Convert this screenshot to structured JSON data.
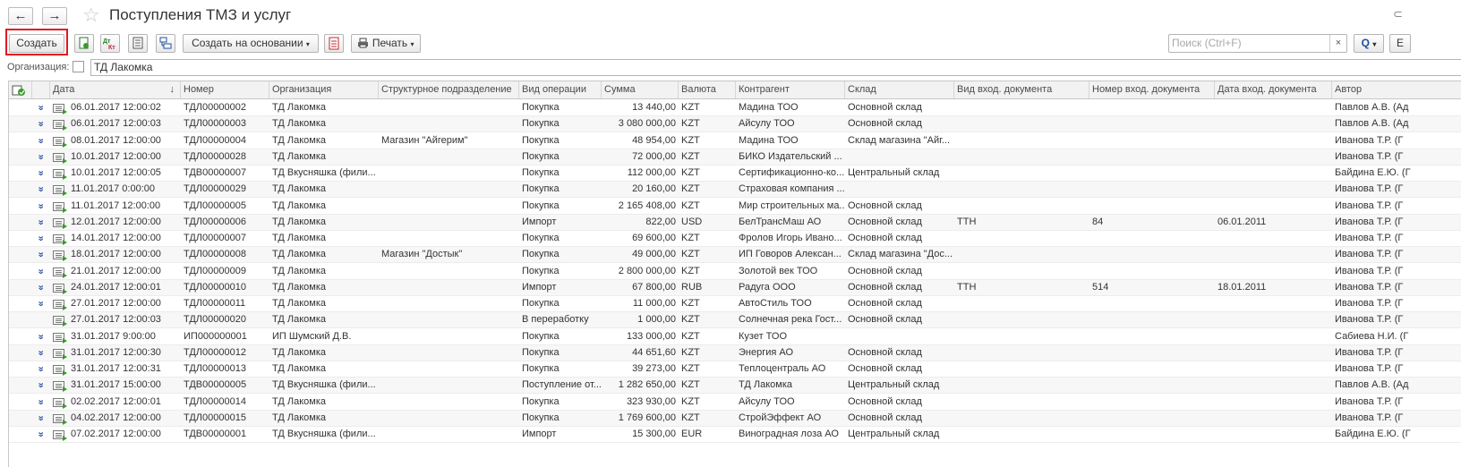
{
  "header": {
    "back_icon": "←",
    "forward_icon": "→",
    "favorite_icon": "☆",
    "title": "Поступления ТМЗ и услуг",
    "link_icon": "⊂"
  },
  "toolbar": {
    "create_label": "Создать",
    "create_based_label": "Создать на основании",
    "print_label": "Печать",
    "search_placeholder": "Поиск (Ctrl+F)",
    "clear_icon": "×",
    "search_icon": "Q",
    "more_label": "Е"
  },
  "filter": {
    "org_label": "Организация:",
    "org_value": "ТД Лакомка"
  },
  "columns": {
    "date": "Дата",
    "number": "Номер",
    "org": "Организация",
    "subdivision": "Структурное подразделение",
    "operation": "Вид операции",
    "sum": "Сумма",
    "currency": "Валюта",
    "counterparty": "Контрагент",
    "warehouse": "Склад",
    "in_doc_type": "Вид вход. документа",
    "in_doc_number": "Номер вход. документа",
    "in_doc_date": "Дата вход. документа",
    "author": "Автор"
  },
  "rows": [
    {
      "posted": true,
      "date": "06.01.2017 12:00:02",
      "number": "ТДЛ00000002",
      "org": "ТД Лакомка",
      "subdivision": "",
      "operation": "Покупка",
      "sum": "13 440,00",
      "currency": "KZT",
      "counterparty": "Мадина ТОО",
      "warehouse": "Основной склад",
      "in_doc_type": "",
      "in_doc_number": "",
      "in_doc_date": "",
      "author": "Павлов А.В. (Ад"
    },
    {
      "posted": true,
      "date": "06.01.2017 12:00:03",
      "number": "ТДЛ00000003",
      "org": "ТД Лакомка",
      "subdivision": "",
      "operation": "Покупка",
      "sum": "3 080 000,00",
      "currency": "KZT",
      "counterparty": "Айсулу ТОО",
      "warehouse": "Основной склад",
      "in_doc_type": "",
      "in_doc_number": "",
      "in_doc_date": "",
      "author": "Павлов А.В. (Ад"
    },
    {
      "posted": true,
      "date": "08.01.2017 12:00:00",
      "number": "ТДЛ00000004",
      "org": "ТД Лакомка",
      "subdivision": "Магазин \"Айгерим\"",
      "operation": "Покупка",
      "sum": "48 954,00",
      "currency": "KZT",
      "counterparty": "Мадина ТОО",
      "warehouse": "Склад магазина \"Айг...",
      "in_doc_type": "",
      "in_doc_number": "",
      "in_doc_date": "",
      "author": "Иванова Т.Р. (Г"
    },
    {
      "posted": true,
      "date": "10.01.2017 12:00:00",
      "number": "ТДЛ00000028",
      "org": "ТД Лакомка",
      "subdivision": "",
      "operation": "Покупка",
      "sum": "72 000,00",
      "currency": "KZT",
      "counterparty": "БИКО Издательский ...",
      "warehouse": "",
      "in_doc_type": "",
      "in_doc_number": "",
      "in_doc_date": "",
      "author": "Иванова Т.Р. (Г"
    },
    {
      "posted": true,
      "date": "10.01.2017 12:00:05",
      "number": "ТДВ00000007",
      "org": "ТД Вкусняшка (фили...",
      "subdivision": "",
      "operation": "Покупка",
      "sum": "112 000,00",
      "currency": "KZT",
      "counterparty": "Сертификационно-ко...",
      "warehouse": "Центральный склад",
      "in_doc_type": "",
      "in_doc_number": "",
      "in_doc_date": "",
      "author": "Байдина Е.Ю. (Г"
    },
    {
      "posted": true,
      "date": "11.01.2017 0:00:00",
      "number": "ТДЛ00000029",
      "org": "ТД Лакомка",
      "subdivision": "",
      "operation": "Покупка",
      "sum": "20 160,00",
      "currency": "KZT",
      "counterparty": "Страховая компания ...",
      "warehouse": "",
      "in_doc_type": "",
      "in_doc_number": "",
      "in_doc_date": "",
      "author": "Иванова Т.Р. (Г"
    },
    {
      "posted": true,
      "date": "11.01.2017 12:00:00",
      "number": "ТДЛ00000005",
      "org": "ТД Лакомка",
      "subdivision": "",
      "operation": "Покупка",
      "sum": "2 165 408,00",
      "currency": "KZT",
      "counterparty": "Мир строительных ма...",
      "warehouse": "Основной склад",
      "in_doc_type": "",
      "in_doc_number": "",
      "in_doc_date": "",
      "author": "Иванова Т.Р. (Г"
    },
    {
      "posted": true,
      "date": "12.01.2017 12:00:00",
      "number": "ТДЛ00000006",
      "org": "ТД Лакомка",
      "subdivision": "",
      "operation": "Импорт",
      "sum": "822,00",
      "currency": "USD",
      "counterparty": "БелТрансМаш АО",
      "warehouse": "Основной склад",
      "in_doc_type": "ТТН",
      "in_doc_number": "84",
      "in_doc_date": "06.01.2011",
      "author": "Иванова Т.Р. (Г"
    },
    {
      "posted": true,
      "date": "14.01.2017 12:00:00",
      "number": "ТДЛ00000007",
      "org": "ТД Лакомка",
      "subdivision": "",
      "operation": "Покупка",
      "sum": "69 600,00",
      "currency": "KZT",
      "counterparty": "Фролов Игорь Ивано...",
      "warehouse": "Основной склад",
      "in_doc_type": "",
      "in_doc_number": "",
      "in_doc_date": "",
      "author": "Иванова Т.Р. (Г"
    },
    {
      "posted": true,
      "date": "18.01.2017 12:00:00",
      "number": "ТДЛ00000008",
      "org": "ТД Лакомка",
      "subdivision": "Магазин \"Достык\"",
      "operation": "Покупка",
      "sum": "49 000,00",
      "currency": "KZT",
      "counterparty": "ИП Говоров Алексан...",
      "warehouse": "Склад магазина \"Дос...",
      "in_doc_type": "",
      "in_doc_number": "",
      "in_doc_date": "",
      "author": "Иванова Т.Р. (Г"
    },
    {
      "posted": true,
      "date": "21.01.2017 12:00:00",
      "number": "ТДЛ00000009",
      "org": "ТД Лакомка",
      "subdivision": "",
      "operation": "Покупка",
      "sum": "2 800 000,00",
      "currency": "KZT",
      "counterparty": "Золотой век ТОО",
      "warehouse": "Основной склад",
      "in_doc_type": "",
      "in_doc_number": "",
      "in_doc_date": "",
      "author": "Иванова Т.Р. (Г"
    },
    {
      "posted": true,
      "date": "24.01.2017 12:00:01",
      "number": "ТДЛ00000010",
      "org": "ТД Лакомка",
      "subdivision": "",
      "operation": "Импорт",
      "sum": "67 800,00",
      "currency": "RUB",
      "counterparty": "Радуга ООО",
      "warehouse": "Основной склад",
      "in_doc_type": "ТТН",
      "in_doc_number": "514",
      "in_doc_date": "18.01.2011",
      "author": "Иванова Т.Р. (Г"
    },
    {
      "posted": true,
      "date": "27.01.2017 12:00:00",
      "number": "ТДЛ00000011",
      "org": "ТД Лакомка",
      "subdivision": "",
      "operation": "Покупка",
      "sum": "11 000,00",
      "currency": "KZT",
      "counterparty": "АвтоСтиль ТОО",
      "warehouse": "Основной склад",
      "in_doc_type": "",
      "in_doc_number": "",
      "in_doc_date": "",
      "author": "Иванова Т.Р. (Г"
    },
    {
      "posted": false,
      "date": "27.01.2017 12:00:03",
      "number": "ТДЛ00000020",
      "org": "ТД Лакомка",
      "subdivision": "",
      "operation": "В переработку",
      "sum": "1 000,00",
      "currency": "KZT",
      "counterparty": "Солнечная река Гост...",
      "warehouse": "Основной склад",
      "in_doc_type": "",
      "in_doc_number": "",
      "in_doc_date": "",
      "author": "Иванова Т.Р. (Г"
    },
    {
      "posted": true,
      "date": "31.01.2017 9:00:00",
      "number": "ИП000000001",
      "org": "ИП Шумский Д.В.",
      "subdivision": "",
      "operation": "Покупка",
      "sum": "133 000,00",
      "currency": "KZT",
      "counterparty": "Кузет ТОО",
      "warehouse": "",
      "in_doc_type": "",
      "in_doc_number": "",
      "in_doc_date": "",
      "author": "Сабиева Н.И. (Г"
    },
    {
      "posted": true,
      "date": "31.01.2017 12:00:30",
      "number": "ТДЛ00000012",
      "org": "ТД Лакомка",
      "subdivision": "",
      "operation": "Покупка",
      "sum": "44 651,60",
      "currency": "KZT",
      "counterparty": "Энергия АО",
      "warehouse": "Основной склад",
      "in_doc_type": "",
      "in_doc_number": "",
      "in_doc_date": "",
      "author": "Иванова Т.Р. (Г"
    },
    {
      "posted": true,
      "date": "31.01.2017 12:00:31",
      "number": "ТДЛ00000013",
      "org": "ТД Лакомка",
      "subdivision": "",
      "operation": "Покупка",
      "sum": "39 273,00",
      "currency": "KZT",
      "counterparty": "Теплоцентраль АО",
      "warehouse": "Основной склад",
      "in_doc_type": "",
      "in_doc_number": "",
      "in_doc_date": "",
      "author": "Иванова Т.Р. (Г"
    },
    {
      "posted": true,
      "date": "31.01.2017 15:00:00",
      "number": "ТДВ00000005",
      "org": "ТД Вкусняшка (фили...",
      "subdivision": "",
      "operation": "Поступление от...",
      "sum": "1 282 650,00",
      "currency": "KZT",
      "counterparty": "ТД Лакомка",
      "warehouse": "Центральный склад",
      "in_doc_type": "",
      "in_doc_number": "",
      "in_doc_date": "",
      "author": "Павлов А.В. (Ад"
    },
    {
      "posted": true,
      "date": "02.02.2017 12:00:01",
      "number": "ТДЛ00000014",
      "org": "ТД Лакомка",
      "subdivision": "",
      "operation": "Покупка",
      "sum": "323 930,00",
      "currency": "KZT",
      "counterparty": "Айсулу ТОО",
      "warehouse": "Основной склад",
      "in_doc_type": "",
      "in_doc_number": "",
      "in_doc_date": "",
      "author": "Иванова Т.Р. (Г"
    },
    {
      "posted": true,
      "date": "04.02.2017 12:00:00",
      "number": "ТДЛ00000015",
      "org": "ТД Лакомка",
      "subdivision": "",
      "operation": "Покупка",
      "sum": "1 769 600,00",
      "currency": "KZT",
      "counterparty": "СтройЭффект АО",
      "warehouse": "Основной склад",
      "in_doc_type": "",
      "in_doc_number": "",
      "in_doc_date": "",
      "author": "Иванова Т.Р. (Г"
    },
    {
      "posted": true,
      "date": "07.02.2017 12:00:00",
      "number": "ТДВ00000001",
      "org": "ТД Вкусняшка (фили...",
      "subdivision": "",
      "operation": "Импорт",
      "sum": "15 300,00",
      "currency": "EUR",
      "counterparty": "Виноградная лоза АО",
      "warehouse": "Центральный склад",
      "in_doc_type": "",
      "in_doc_number": "",
      "in_doc_date": "",
      "author": "Байдина Е.Ю. (Г"
    }
  ]
}
